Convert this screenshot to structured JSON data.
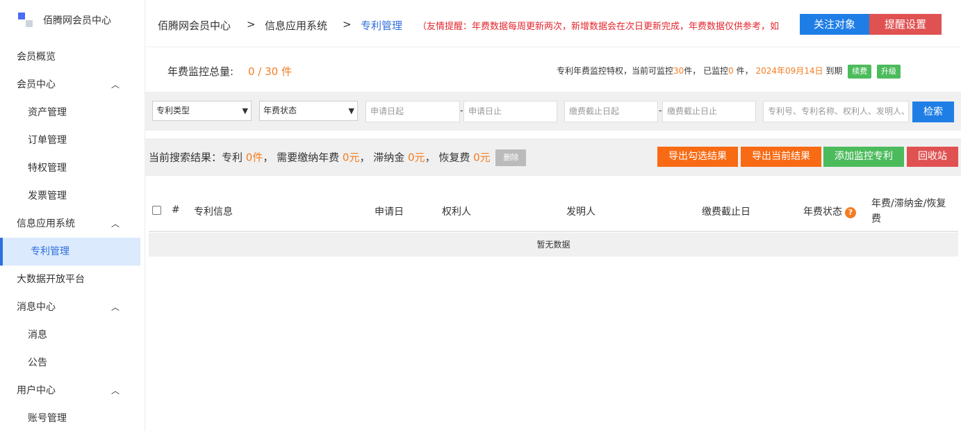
{
  "app": {
    "title": "佰腾网会员中心"
  },
  "sidebar": {
    "items": [
      {
        "label": "会员概览",
        "level": 0
      },
      {
        "label": "会员中心",
        "level": 0,
        "expanded": true
      },
      {
        "label": "资产管理",
        "level": 1
      },
      {
        "label": "订单管理",
        "level": 1
      },
      {
        "label": "特权管理",
        "level": 1
      },
      {
        "label": "发票管理",
        "level": 1
      },
      {
        "label": "信息应用系统",
        "level": 0,
        "expanded": true
      },
      {
        "label": "专利管理",
        "level": 1,
        "active": true
      },
      {
        "label": "大数据开放平台",
        "level": 0
      },
      {
        "label": "消息中心",
        "level": 0,
        "expanded": true
      },
      {
        "label": "消息",
        "level": 1
      },
      {
        "label": "公告",
        "level": 1
      },
      {
        "label": "用户中心",
        "level": 0,
        "expanded": true
      },
      {
        "label": "账号管理",
        "level": 1
      }
    ]
  },
  "breadcrumb": {
    "items": [
      "佰腾网会员中心",
      "信息应用系统",
      "专利管理"
    ],
    "separator": ">"
  },
  "notice": "（友情提醒：年费数据每周更新两次，新增数据会在次日更新完成，年费数据仅供参考，如",
  "header_buttons": {
    "follow": "关注对象",
    "remind": "提醒设置"
  },
  "quota": {
    "label": "年费监控总量:",
    "value": "0 / 30 件"
  },
  "privilege": {
    "prefix": "专利年费监控特权，当前可监控",
    "can_monitor": "30",
    "mid1": "件，  已监控",
    "monitored": "0",
    "mid2": "件，",
    "expire_date": "2024年09月14日",
    "suffix": "到期",
    "renew": "续费",
    "upgrade": "升级"
  },
  "filters": {
    "patent_type": "专利类型",
    "fee_status": "年费状态",
    "apply_start": "申请日起",
    "apply_end": "申请日止",
    "deadline_start": "缴费截止日起",
    "deadline_end": "缴费截止日止",
    "keyword": "专利号、专利名称、权利人、发明人、",
    "search": "检索"
  },
  "results": {
    "prefix": "当前搜索结果：专利",
    "count": "0件",
    "fee_label": "， 需要缴纳年费",
    "fee": "0元",
    "late_label": "， 滞纳金",
    "late": "0元",
    "restore_label": "， 恢复费",
    "restore": "0元",
    "delete": "删除",
    "actions": [
      "导出勾选结果",
      "导出当前结果",
      "添加监控专利",
      "回收站"
    ]
  },
  "table": {
    "columns": [
      "#",
      "专利信息",
      "申请日",
      "权利人",
      "发明人",
      "缴费截止日",
      "年费状态",
      "年费/滞纳金/恢复费"
    ],
    "help_icon": "?",
    "empty": "暂无数据"
  },
  "colors": {
    "accent_blue": "#1f7ee6",
    "orange": "#f47c20",
    "green": "#4cbb5c",
    "red": "#e05252",
    "notice_red": "#e4262d"
  }
}
